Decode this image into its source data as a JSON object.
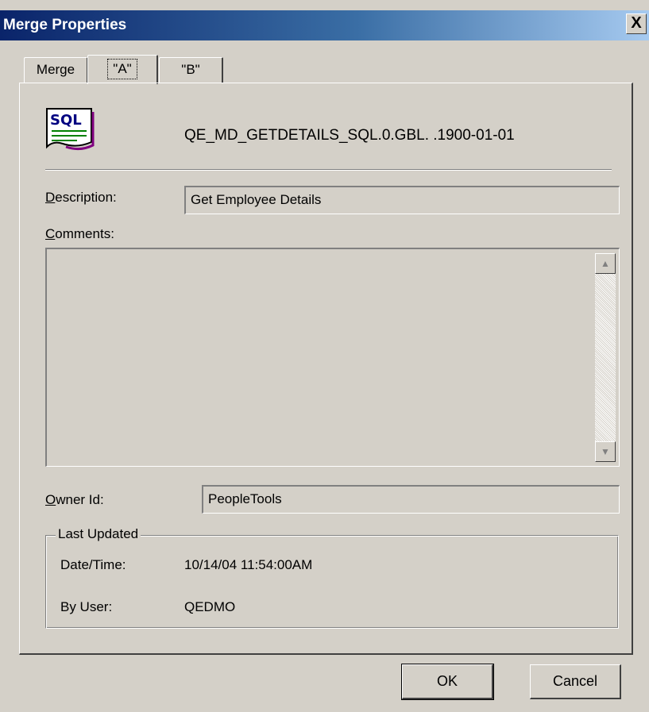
{
  "window": {
    "title": "Merge Properties",
    "close_label": "X"
  },
  "tabs": [
    {
      "label": "Merge"
    },
    {
      "label": "\"A\""
    },
    {
      "label": "\"B\""
    }
  ],
  "object": {
    "icon_label": "SQL",
    "name": "QE_MD_GETDETAILS_SQL.0.GBL. .1900-01-01"
  },
  "description": {
    "label_accel": "D",
    "label_rest": "escription:",
    "value": "Get Employee Details"
  },
  "comments": {
    "label_accel": "C",
    "label_rest": "omments:",
    "value": ""
  },
  "owner": {
    "label_accel": "O",
    "label_rest": "wner Id:",
    "value": "PeopleTools"
  },
  "last_updated": {
    "legend": "Last Updated",
    "datetime_label": "Date/Time:",
    "datetime_value": "10/14/04 11:54:00AM",
    "user_label": "By User:",
    "user_value": "QEDMO"
  },
  "buttons": {
    "ok": "OK",
    "cancel": "Cancel"
  },
  "colors": {
    "titlebar_start": "#0a246a",
    "titlebar_end": "#a6caf0",
    "face": "#d4d0c8"
  }
}
